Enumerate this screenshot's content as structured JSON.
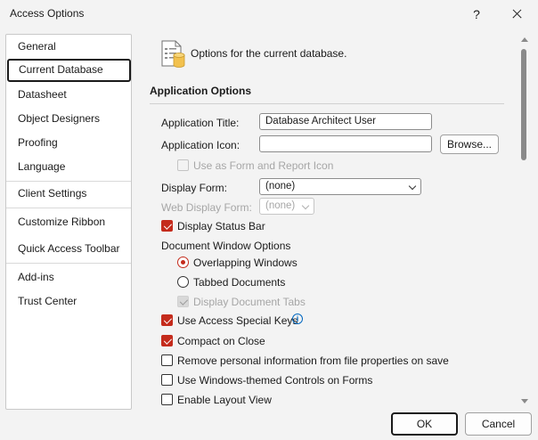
{
  "window": {
    "title": "Access Options",
    "help_label": "?",
    "close_icon": "close-icon"
  },
  "sidebar": {
    "items": [
      {
        "label": "General",
        "selected": false
      },
      {
        "label": "Current Database",
        "selected": true
      },
      {
        "label": "Datasheet",
        "selected": false
      },
      {
        "label": "Object Designers",
        "selected": false
      },
      {
        "label": "Proofing",
        "selected": false
      },
      {
        "label": "Language",
        "selected": false
      },
      {
        "label": "Client Settings",
        "selected": false
      },
      {
        "label": "Customize Ribbon",
        "selected": false
      },
      {
        "label": "Quick Access Toolbar",
        "selected": false
      },
      {
        "label": "Add-ins",
        "selected": false
      },
      {
        "label": "Trust Center",
        "selected": false
      }
    ]
  },
  "main": {
    "header_icon": "database-options-icon",
    "header_text": "Options for the current database.",
    "section_title": "Application Options",
    "app_title": {
      "label": "Application Title:",
      "value": "Database Architect User"
    },
    "app_icon": {
      "label": "Application Icon:",
      "value": "",
      "browse_label": "Browse..."
    },
    "use_as_form_icon": {
      "label": "Use as Form and Report Icon",
      "checked": false,
      "enabled": false
    },
    "display_form": {
      "label": "Display Form:",
      "value": "(none)"
    },
    "web_display_form": {
      "label": "Web Display Form:",
      "value": "(none)",
      "enabled": false
    },
    "display_status_bar": {
      "label": "Display Status Bar",
      "checked": true
    },
    "doc_window_options": {
      "label": "Document Window Options",
      "overlapping": {
        "label": "Overlapping Windows",
        "selected": true
      },
      "tabbed": {
        "label": "Tabbed Documents",
        "selected": false
      },
      "display_doc_tabs": {
        "label": "Display Document Tabs",
        "checked": true,
        "enabled": false
      }
    },
    "use_access_special_keys": {
      "label": "Use Access Special Keys",
      "checked": true,
      "info_icon": "info-icon"
    },
    "compact_on_close": {
      "label": "Compact on Close",
      "checked": true
    },
    "remove_personal_info": {
      "label": "Remove personal information from file properties on save",
      "checked": false
    },
    "use_windows_themed": {
      "label": "Use Windows-themed Controls on Forms",
      "checked": false
    },
    "enable_layout_view": {
      "label": "Enable Layout View",
      "checked": false
    }
  },
  "footer": {
    "ok_label": "OK",
    "cancel_label": "Cancel"
  },
  "colors": {
    "accent": "#c42b1c",
    "background": "#f3f3f3",
    "info": "#0067c0"
  }
}
